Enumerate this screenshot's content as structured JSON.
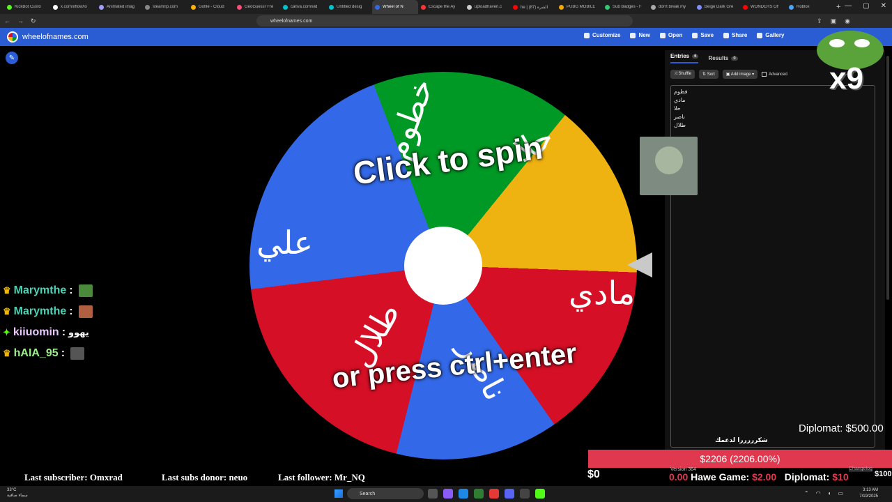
{
  "browser": {
    "tabs": [
      {
        "label": "KickBot Custo",
        "color": "#53fc18"
      },
      {
        "label": "x.com/i/flow/lo",
        "color": "#ffffff"
      },
      {
        "label": "Animated imag",
        "color": "#a0a0ff"
      },
      {
        "label": "steamrip.com",
        "color": "#888888"
      },
      {
        "label": "Gofile - Cloud",
        "color": "#ffb000"
      },
      {
        "label": "GeoGuessr Fre",
        "color": "#ff4d7a"
      },
      {
        "label": "canva.com/vid",
        "color": "#00c4cc"
      },
      {
        "label": "Untitled desig",
        "color": "#00c4cc"
      },
      {
        "label": "Wheel of N",
        "color": "#3369e8"
      },
      {
        "label": "Escape the Ay",
        "color": "#ff3333"
      },
      {
        "label": "uploadhaven.c",
        "color": "#cccccc"
      },
      {
        "label": "he | الشرة (87)",
        "color": "#ff0000"
      },
      {
        "label": "PUBG MOBILE",
        "color": "#f2a900"
      },
      {
        "label": "Sub Badges - F",
        "color": "#2ecc71"
      },
      {
        "label": "don't break my",
        "color": "#aaaaaa"
      },
      {
        "label": "Beige Dark Gre",
        "color": "#7f8cff"
      },
      {
        "label": "WONDERS OF",
        "color": "#ff0000"
      },
      {
        "label": "Roblox",
        "color": "#4ba3ff"
      }
    ],
    "new_tab": "+",
    "url": "wheelofnames.com"
  },
  "app": {
    "site_title": "wheelofnames.com",
    "menu": [
      "Customize",
      "New",
      "Open",
      "Save",
      "Share",
      "Gallery"
    ]
  },
  "wheel": {
    "segments": [
      "خطوم",
      "حلا",
      "مادي",
      "ناصر",
      "طلال",
      "علي"
    ],
    "click_to_spin": "Click to spin",
    "or_press": "or press ctrl+enter"
  },
  "sidebar": {
    "tab_entries": "Entries",
    "entries_count": "6",
    "tab_results": "Results",
    "results_count": "0",
    "shuffle": "Shuffle",
    "sort": "Sort",
    "add_image": "Add image",
    "advanced": "Advanced",
    "entries": [
      "فطوم",
      "مادي",
      "حلا",
      "ناصر",
      "طلال"
    ]
  },
  "overlay": {
    "x9": "x9",
    "chat": [
      {
        "user": "Marymthe",
        "color": "#4ad3b5",
        "msg": "",
        "emote": "#4a8a3a"
      },
      {
        "user": "Marymthe",
        "color": "#4ad3b5",
        "msg": "",
        "emote": "#b06040"
      },
      {
        "user": "kiiuomin",
        "color": "#e8c8ff",
        "msg": "يهوو",
        "emote": ""
      },
      {
        "user": "hAIA_95",
        "color": "#9cf08a",
        "msg": "",
        "emote": "#555555"
      }
    ],
    "last_subscriber": "Last subscriber: Omxrad",
    "last_subs_donor": "Last subs donor: neuo",
    "last_follower": "Last follower: Mr_NQ",
    "diplomat_top": "Diplomat: $500.00",
    "thanks": "شكرررررا لدعمك",
    "goal": "$2206 (2206.00%)",
    "goal_zero": "$0",
    "version": "Version 364",
    "hawe_label": "Hawe Game: ",
    "hawe_value": "$2.00",
    "hawe_zero": "0.00",
    "diplomat_bottom": "Diplomat: ",
    "diplomat_bottom_value": "$10",
    "changelog": "Changelog",
    "hundred": "$100"
  },
  "taskbar": {
    "weather_temp": "33°C",
    "weather_desc": "سماء صافية",
    "search_placeholder": "Search",
    "time": "3:13 AM",
    "date": "7/19/2025"
  }
}
